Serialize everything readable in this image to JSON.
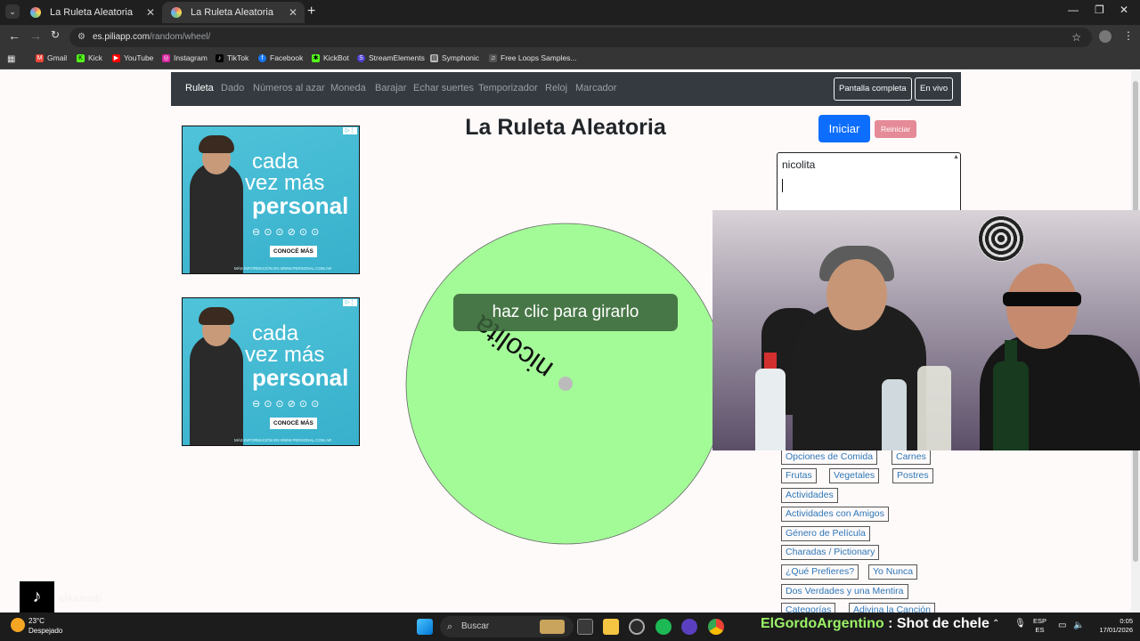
{
  "browser": {
    "tabs": [
      {
        "title": "La Ruleta Aleatoria"
      },
      {
        "title": "La Ruleta Aleatoria"
      }
    ],
    "url_host": "es.piliapp.com",
    "url_path": "/random/wheel/",
    "bookmarks": [
      "Gmail",
      "Kick",
      "YouTube",
      "Instagram",
      "TikTok",
      "Facebook",
      "KickBot",
      "StreamElements",
      "Symphonic",
      "Free Loops Samples..."
    ]
  },
  "site_nav": {
    "links": [
      "Ruleta",
      "Dado",
      "Números al azar",
      "Moneda",
      "Barajar",
      "Echar suertes",
      "Temporizador",
      "Reloj",
      "Marcador"
    ],
    "fullscreen_label": "Pantalla completa",
    "live_label": "En vivo"
  },
  "ads": [
    {
      "line1": "cada",
      "line2": "vez más",
      "line3": "personal",
      "cta": "CONOCÉ MÁS",
      "fine": "MÁS INFORMACIÓN EN WWW.PERSONAL.COM.AR"
    },
    {
      "line1": "cada",
      "line2": "vez más",
      "line3": "personal",
      "cta": "CONOCÉ MÁS",
      "fine": "MÁS INFORMACIÓN EN WWW.PERSONAL.COM.AR"
    }
  ],
  "main": {
    "title": "La Ruleta Aleatoria",
    "wheel_entry": "nicolita",
    "wheel_color": "#a3fb98",
    "spin_prompt": "haz clic para girarlo",
    "start_label": "Iniciar",
    "reset_label": "Reiniciar",
    "names_value": "nicolita"
  },
  "presets": [
    "Opciones de Comida",
    "Carnes",
    "Frutas",
    "Vegetales",
    "Postres",
    "Actividades",
    "Actividades con Amigos",
    "Género de Película",
    "Charadas / Pictionary",
    "¿Qué Prefieres?",
    "Yo Nunca",
    "Dos Verdades y una Mentira",
    "Categorías",
    "Adivina la Canción"
  ],
  "taskbar": {
    "weather_temp": "23°C",
    "weather_desc": "Despejado",
    "search_placeholder": "Buscar",
    "ticker_user": "ElGordoArgentino",
    "ticker_msg": " : Shot de chele",
    "lang_line1": "ESP",
    "lang_line2": "ES",
    "time": "0:05",
    "date": "17/01/2026"
  },
  "overlay": {
    "tiktok_handle": "elkanadi"
  }
}
